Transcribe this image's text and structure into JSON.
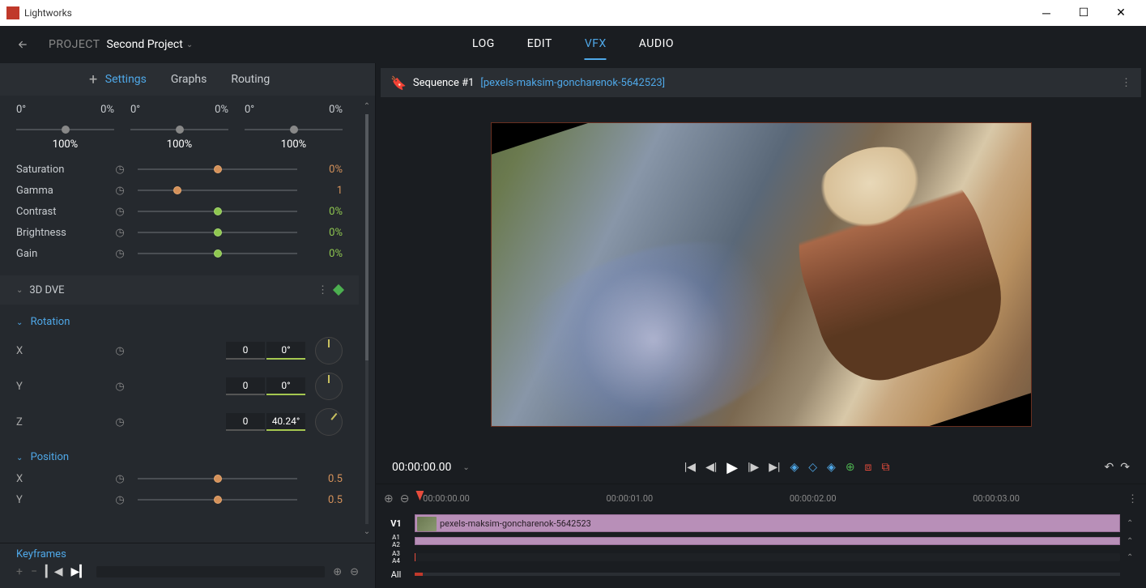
{
  "window": {
    "title": "Lightworks"
  },
  "topbar": {
    "project_label": "PROJECT",
    "project_name": "Second Project",
    "tabs": {
      "log": "LOG",
      "edit": "EDIT",
      "vfx": "VFX",
      "audio": "AUDIO"
    }
  },
  "panel": {
    "tabs": {
      "settings": "Settings",
      "graphs": "Graphs",
      "routing": "Routing"
    },
    "triple": [
      {
        "angle": "0°",
        "pct": "0%",
        "scale": "100%"
      },
      {
        "angle": "0°",
        "pct": "0%",
        "scale": "100%"
      },
      {
        "angle": "0°",
        "pct": "0%",
        "scale": "100%"
      }
    ],
    "params": [
      {
        "label": "Saturation",
        "value": "0%",
        "color": "orange",
        "pos": 50
      },
      {
        "label": "Gamma",
        "value": "1",
        "color": "orange",
        "pos": 25
      },
      {
        "label": "Contrast",
        "value": "0%",
        "color": "green",
        "pos": 50
      },
      {
        "label": "Brightness",
        "value": "0%",
        "color": "green",
        "pos": 50
      },
      {
        "label": "Gain",
        "value": "0%",
        "color": "green",
        "pos": 50
      }
    ],
    "dve": {
      "title": "3D DVE",
      "rotation": {
        "title": "Rotation",
        "x_label": "X",
        "x_turns": "0",
        "x_deg": "0°",
        "y_label": "Y",
        "y_turns": "0",
        "y_deg": "0°",
        "z_label": "Z",
        "z_turns": "0",
        "z_deg": "40.24°"
      },
      "position": {
        "title": "Position",
        "x_label": "X",
        "x_value": "0.5",
        "y_label": "Y",
        "y_value": "0.5"
      }
    },
    "keyframes": {
      "title": "Keyframes"
    }
  },
  "preview": {
    "sequence": "Sequence #1",
    "clip": "[pexels-maksim-goncharenok-5642523]",
    "timecode": "00:00:00.00"
  },
  "timeline": {
    "ticks": [
      "00:00:00.00",
      "00:00:01.00",
      "00:00:02.00",
      "00:00:03.00"
    ],
    "v1_label": "V1",
    "a12_label_1": "A1",
    "a12_label_2": "A2",
    "a34_label_1": "A3",
    "a34_label_2": "A4",
    "all_label": "All",
    "clip_name": "pexels-maksim-goncharenok-5642523"
  }
}
